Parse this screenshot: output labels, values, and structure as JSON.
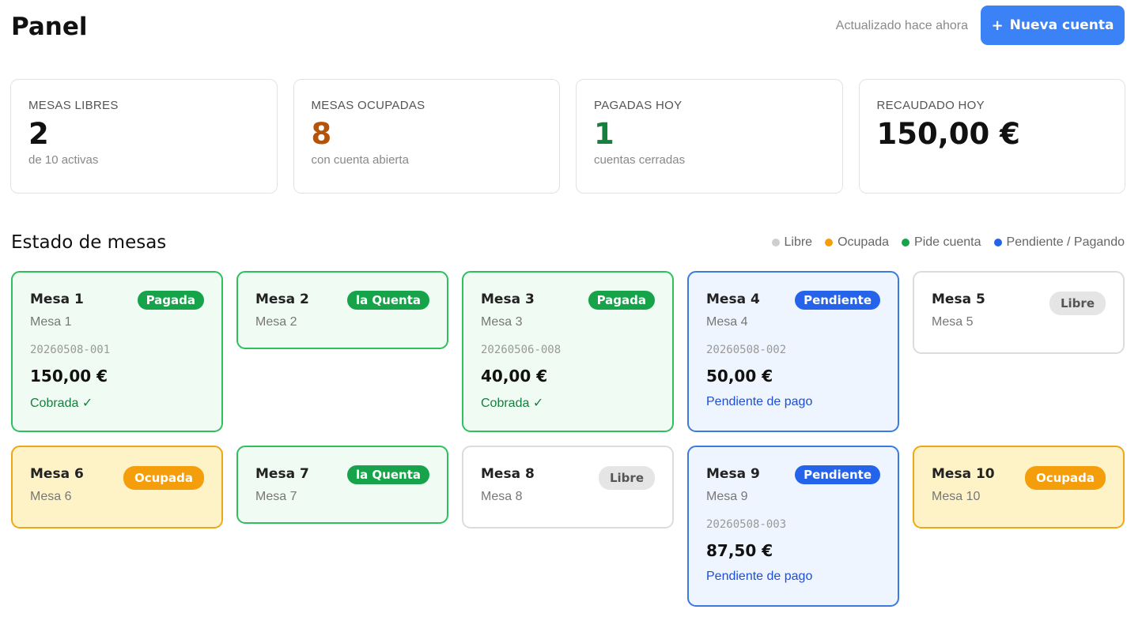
{
  "header": {
    "title": "Panel",
    "updated": "Actualizado hace ahora",
    "new_button": "Nueva cuenta",
    "new_button_icon": "+"
  },
  "stats": [
    {
      "label": "MESAS LIBRES",
      "value": "2",
      "sub": "de 10 activas",
      "color": "#111111"
    },
    {
      "label": "MESAS OCUPADAS",
      "value": "8",
      "sub": "con cuenta abierta",
      "color": "#b45309"
    },
    {
      "label": "PAGADAS HOY",
      "value": "1",
      "sub": "cuentas cerradas",
      "color": "#15803d"
    },
    {
      "label": "RECAUDADO HOY",
      "value": "150,00 €",
      "sub": "",
      "color": "#111111"
    }
  ],
  "section": {
    "title": "Estado de mesas",
    "legend": [
      {
        "label": "Libre",
        "color": "#cfcfcf"
      },
      {
        "label": "Ocupada",
        "color": "#f59e0b"
      },
      {
        "label": "Pide cuenta",
        "color": "#16a34a"
      },
      {
        "label": "Pendiente / Pagando",
        "color": "#2563eb"
      }
    ]
  },
  "tables": [
    {
      "name": "Mesa 1",
      "sub": "Mesa 1",
      "badge": "Pagada",
      "ticket": "20260508-001",
      "amount": "150,00 €",
      "status": "Cobrada ✓"
    },
    {
      "name": "Mesa 2",
      "sub": "Mesa 2",
      "badge": "la Quenta",
      "ticket": "",
      "amount": "",
      "status": ""
    },
    {
      "name": "Mesa 3",
      "sub": "Mesa 3",
      "badge": "Pagada",
      "ticket": "20260506-008",
      "amount": "40,00 €",
      "status": "Cobrada ✓"
    },
    {
      "name": "Mesa 4",
      "sub": "Mesa 4",
      "badge": "Pendiente",
      "ticket": "20260508-002",
      "amount": "50,00 €",
      "status": "Pendiente de pago"
    },
    {
      "name": "Mesa 5",
      "sub": "Mesa 5",
      "badge": "Libre",
      "ticket": "",
      "amount": "",
      "status": ""
    },
    {
      "name": "Mesa 6",
      "sub": "Mesa 6",
      "badge": "Ocupada",
      "ticket": "",
      "amount": "",
      "status": ""
    },
    {
      "name": "Mesa 7",
      "sub": "Mesa 7",
      "badge": "la Quenta",
      "ticket": "",
      "amount": "",
      "status": ""
    },
    {
      "name": "Mesa 8",
      "sub": "Mesa 8",
      "badge": "Libre",
      "ticket": "",
      "amount": "",
      "status": ""
    },
    {
      "name": "Mesa 9",
      "sub": "Mesa 9",
      "badge": "Pendiente",
      "ticket": "20260508-003",
      "amount": "87,50 €",
      "status": "Pendiente de pago"
    },
    {
      "name": "Mesa 10",
      "sub": "Mesa 10",
      "badge": "Ocupada",
      "ticket": "",
      "amount": "",
      "status": ""
    }
  ]
}
